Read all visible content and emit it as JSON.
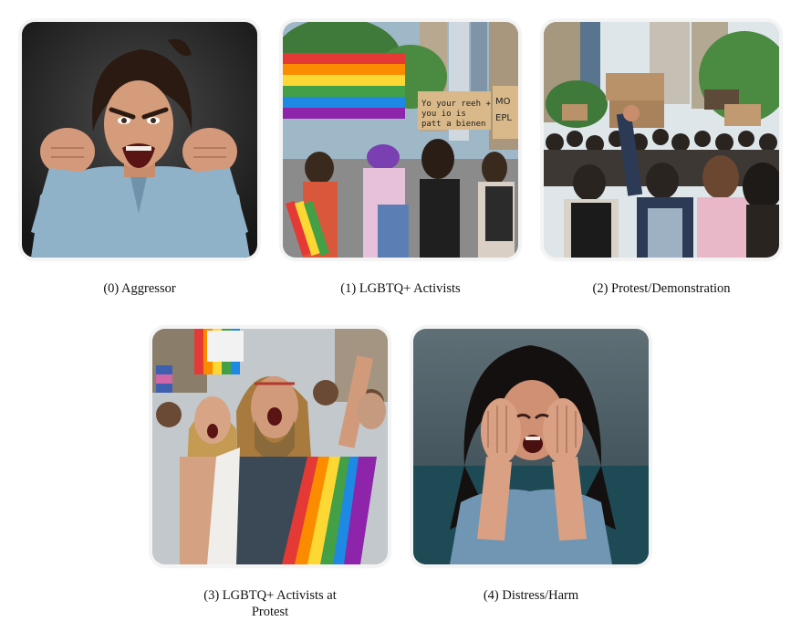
{
  "panels": [
    {
      "index": "(0)",
      "caption": "(0) Aggressor"
    },
    {
      "index": "(1)",
      "caption": "(1) LGBTQ+ Activists"
    },
    {
      "index": "(2)",
      "caption": "(2) Protest/Demonstration"
    },
    {
      "index": "(3)",
      "caption": "(3) LGBTQ+ Activists at Protest"
    },
    {
      "index": "(4)",
      "caption": "(4) Distress/Harm"
    }
  ],
  "signs": {
    "panel1_sign_left": "Yo your reeh + you io is patt a bienen",
    "panel1_sign_right": "MO EPL"
  },
  "colors": {
    "rainbow": [
      "#e53935",
      "#fb8c00",
      "#fdd835",
      "#43a047",
      "#1e88e5",
      "#8e24aa"
    ],
    "card_outline": "#f4f4f4"
  }
}
